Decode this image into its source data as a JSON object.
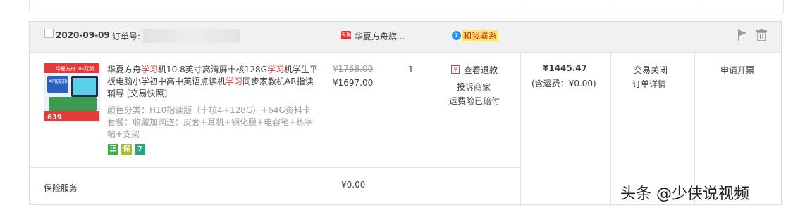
{
  "order": {
    "date": "2020-09-09",
    "order_no_label": "订单号:",
    "shop_icon_text": "天猫",
    "shop_name": "华夏方舟旗...",
    "chat_label": "和我联系",
    "chat_icon_text": "1"
  },
  "product": {
    "title_parts": [
      "华夏方舟",
      "学习",
      "机10.8英寸高清屏十核128G",
      "学习",
      "机学生平板电脑小学初中高中英语点读机",
      "学习",
      "同步家教机AR指读辅导 [交易快照]"
    ],
    "sku": "颜色分类：H10指读版（十核4+128G）+64G资料卡   套餐：收藏加购送：皮套+耳机+钢化膜+电容笔+练字帖+支架",
    "image_text": {
      "top": "华夏方舟 5G双频",
      "ar": "AR智能指读",
      "price": "639"
    },
    "badges": [
      {
        "label": "正",
        "color": "#3aae48",
        "icon": "genuine-icon"
      },
      {
        "label": "保",
        "color": "#a2c523",
        "icon": "guarantee-icon"
      },
      {
        "label": "7",
        "color": "#2aa67a",
        "icon": "seven-day-return-icon"
      }
    ],
    "price_original": "¥1768.00",
    "price_current": "¥1697.00",
    "quantity": "1",
    "refund_icon_text": "¥",
    "refund_link": "查看退款",
    "complain_link": "投诉商家",
    "insurance_text": "运费险已赔付"
  },
  "totals": {
    "amount": "¥1445.47",
    "shipping_note": "(含运费：¥0.00)",
    "status": "交易关闭",
    "detail_link": "订单详情",
    "invoice_link": "申请开票"
  },
  "service": {
    "label": "保险服务",
    "price": "¥0.00"
  },
  "watermark": "头条 @少侠说视频"
}
